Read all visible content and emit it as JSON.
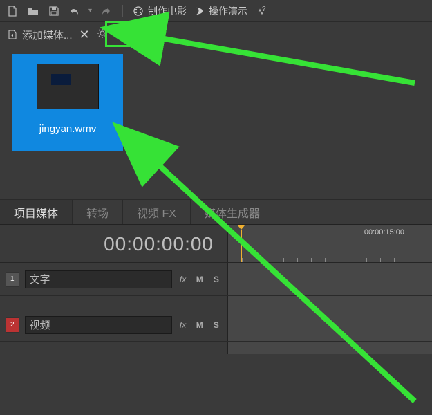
{
  "toolbar": {
    "make_movie": "制作电影",
    "demo": "操作演示"
  },
  "panel": {
    "add_media": "添加媒体..."
  },
  "media": {
    "filename": "jingyan.wmv"
  },
  "tabs": {
    "project_media": "项目媒体",
    "transitions": "转场",
    "video_fx": "视频 FX",
    "media_generators": "媒体生成器"
  },
  "timeline": {
    "timecode": "00:00:00:00",
    "ruler_label": "00:00:15:00",
    "tracks": [
      {
        "num": "1",
        "name": "文字",
        "fx": "fx",
        "m": "M",
        "s": "S",
        "red": false
      },
      {
        "num": "2",
        "name": "视频",
        "fx": "fx",
        "m": "M",
        "s": "S",
        "red": true
      }
    ]
  }
}
